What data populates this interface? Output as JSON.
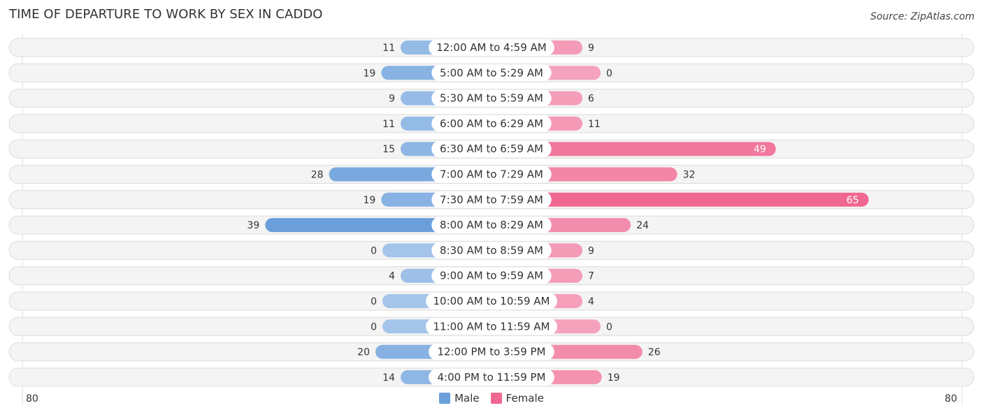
{
  "header": {
    "title": "TIME OF DEPARTURE TO WORK BY SEX IN CADDO",
    "source": "Source: ZipAtlas.com"
  },
  "colors": {
    "male": "#6a9fdb",
    "male_light": "#a4c4ea",
    "female": "#f06891",
    "female_light": "#f5a3bd",
    "row_bg": "#f4f4f4"
  },
  "chart_data": {
    "type": "bar",
    "orientation": "horizontal-diverging",
    "title": "TIME OF DEPARTURE TO WORK BY SEX IN CADDO",
    "categories": [
      "12:00 AM to 4:59 AM",
      "5:00 AM to 5:29 AM",
      "5:30 AM to 5:59 AM",
      "6:00 AM to 6:29 AM",
      "6:30 AM to 6:59 AM",
      "7:00 AM to 7:29 AM",
      "7:30 AM to 7:59 AM",
      "8:00 AM to 8:29 AM",
      "8:30 AM to 8:59 AM",
      "9:00 AM to 9:59 AM",
      "10:00 AM to 10:59 AM",
      "11:00 AM to 11:59 AM",
      "12:00 PM to 3:59 PM",
      "4:00 PM to 11:59 PM"
    ],
    "series": [
      {
        "name": "Male",
        "values": [
          11,
          19,
          9,
          11,
          15,
          28,
          19,
          39,
          0,
          4,
          0,
          0,
          20,
          14
        ]
      },
      {
        "name": "Female",
        "values": [
          9,
          0,
          6,
          11,
          49,
          32,
          65,
          24,
          9,
          7,
          4,
          0,
          26,
          19
        ]
      }
    ],
    "axis": {
      "left_label": "80",
      "right_label": "80",
      "range": [
        -80,
        80
      ]
    },
    "legend": {
      "position": "bottom-center",
      "entries": [
        "Male",
        "Female"
      ]
    }
  }
}
